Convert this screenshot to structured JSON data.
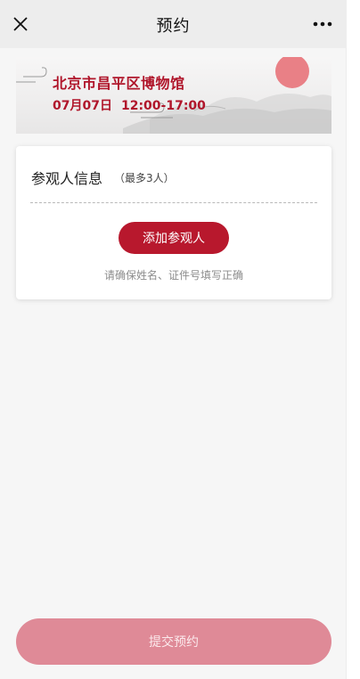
{
  "header": {
    "title": "预约",
    "close_icon": "close-icon",
    "more_icon": "more-icon"
  },
  "banner": {
    "venue": "北京市昌平区博物馆",
    "date": "07月07日",
    "time": "12:00-17:00",
    "accent_color": "#b0162b"
  },
  "visitor_section": {
    "title": "参观人信息",
    "note": "（最多3人）",
    "add_label": "添加参观人",
    "hint": "请确保姓名、证件号填写正确"
  },
  "submit": {
    "label": "提交预约",
    "color": "#df8a97"
  }
}
